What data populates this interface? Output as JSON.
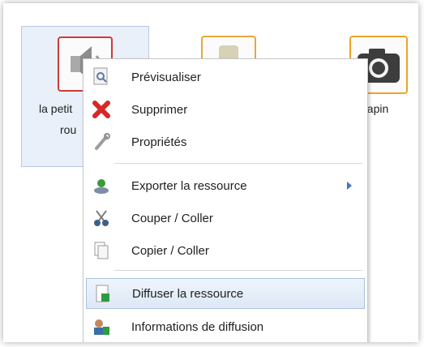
{
  "files": [
    {
      "label_line1": "la petit",
      "label_line2": "rou"
    },
    {
      "label": "Lapin"
    }
  ],
  "context_menu": {
    "items": [
      {
        "label": "Prévisualiser",
        "icon": "magnifier-icon"
      },
      {
        "label": "Supprimer",
        "icon": "delete-x-icon"
      },
      {
        "label": "Propriétés",
        "icon": "wrench-icon"
      },
      {
        "label": "Exporter la ressource",
        "icon": "export-icon",
        "has_submenu": true
      },
      {
        "label": "Couper / Coller",
        "icon": "scissors-icon"
      },
      {
        "label": "Copier / Coller",
        "icon": "copy-icon"
      },
      {
        "label": "Diffuser la ressource",
        "icon": "diffuse-icon",
        "highlighted": true
      },
      {
        "label": "Informations de diffusion",
        "icon": "diffusion-info-icon"
      }
    ]
  },
  "colors": {
    "selection_bg": "#e9f0fa",
    "highlight_border": "#a8c2e2",
    "submenu_arrow": "#3a78c8",
    "delete_red": "#d82727"
  }
}
